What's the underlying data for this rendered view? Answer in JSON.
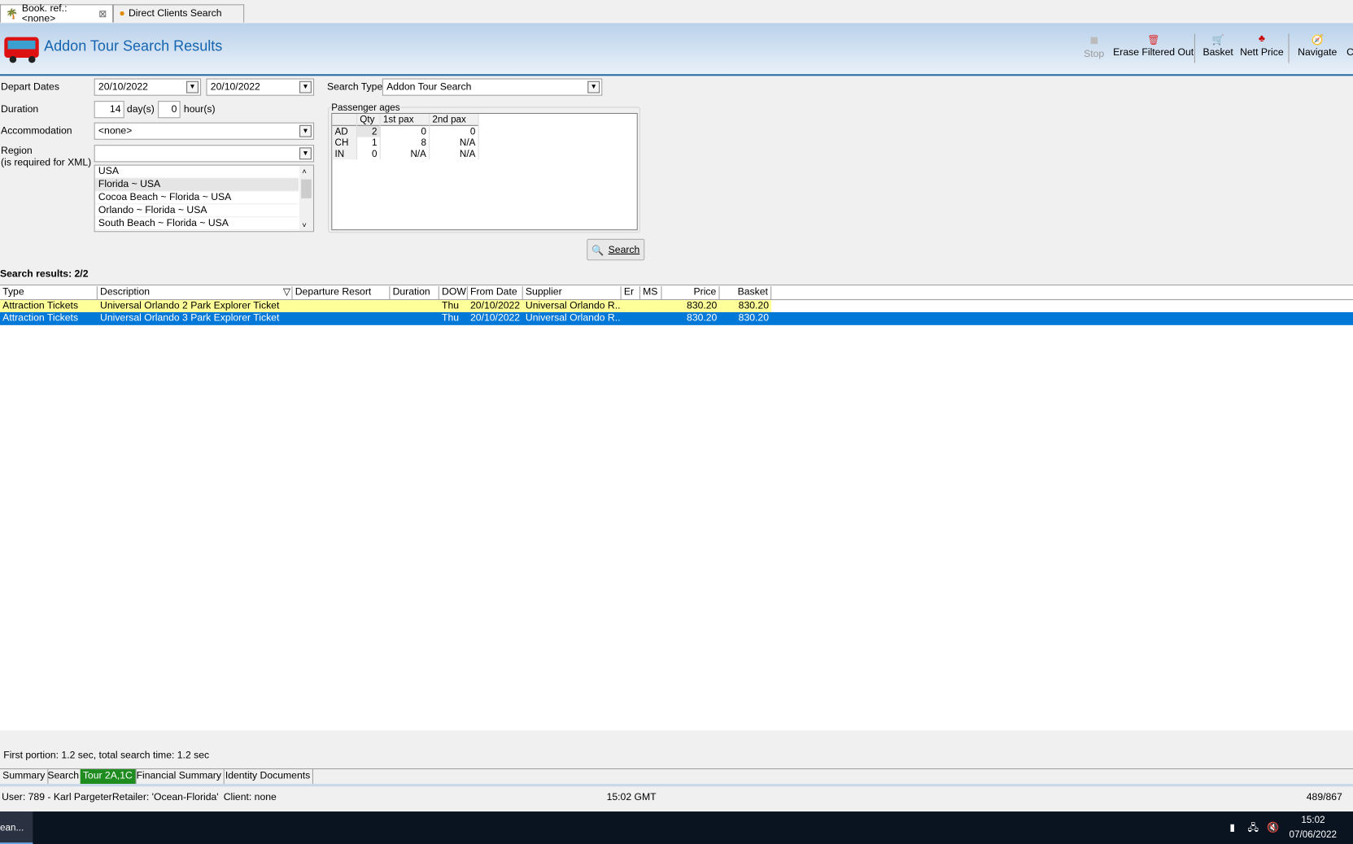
{
  "tabs": [
    {
      "label": "Book. ref.: <none>"
    },
    {
      "label": "Direct Clients Search"
    }
  ],
  "header": {
    "title": "Addon Tour Search Results"
  },
  "toolbar": {
    "stop": "Stop",
    "erase": "Erase Filtered Out",
    "basket": "Basket",
    "nett": "Nett Price",
    "navigate": "Navigate",
    "cl": "Cl"
  },
  "form": {
    "depart_label": "Depart Dates",
    "depart_from": "20/10/2022",
    "depart_to": "20/10/2022",
    "duration_label": "Duration",
    "days": "14",
    "days_unit": "day(s)",
    "hours": "0",
    "hours_unit": "hour(s)",
    "accommodation_label": "Accommodation",
    "accommodation": "<none>",
    "region_label": "Region",
    "region_note": "(is required for XML)",
    "region": "",
    "region_options": [
      "USA",
      "Florida ~ USA",
      "Cocoa Beach ~ Florida ~ USA",
      "Orlando ~ Florida ~ USA",
      "South Beach ~ Florida ~ USA"
    ],
    "search_type_label": "Search Type",
    "search_type": "Addon Tour Search",
    "pax_label": "Passenger ages",
    "pax_headers": [
      "",
      "Qty",
      "1st pax",
      "2nd pax"
    ],
    "pax_rows": [
      [
        "AD",
        "2",
        "0",
        "0"
      ],
      [
        "CH",
        "1",
        "8",
        "N/A"
      ],
      [
        "IN",
        "0",
        "N/A",
        "N/A"
      ]
    ],
    "search_button": "Search"
  },
  "results": {
    "summary": "Search results: 2/2",
    "columns": [
      "Type",
      "Description",
      "Departure Resort",
      "Duration",
      "DOW",
      "From Date",
      "Supplier",
      "Er",
      "MS",
      "Price",
      "Basket"
    ],
    "rows": [
      [
        "Attraction Tickets",
        "Universal Orlando 2 Park Explorer Ticket",
        "",
        "",
        "Thu",
        "20/10/2022",
        "Universal Orlando R...",
        "",
        "",
        "830.20",
        "830.20"
      ],
      [
        "Attraction Tickets",
        "Universal Orlando 3 Park Explorer Ticket",
        "",
        "",
        "Thu",
        "20/10/2022",
        "Universal Orlando R...",
        "",
        "",
        "830.20",
        "830.20"
      ]
    ]
  },
  "timing": "First portion: 1.2 sec, total search time: 1.2 sec",
  "bottom_tabs": [
    "Summary",
    "Search",
    "Tour 2A,1C",
    "Financial Summary",
    "Identity Documents"
  ],
  "status": {
    "user": "User: 789 - Karl Pargeter",
    "retailer": "Retailer: 'Ocean-Florida'",
    "client": "Client: none",
    "time": "15:02 GMT",
    "count": "489/867"
  },
  "taskbar": {
    "app": "ean...",
    "clock": "15:02",
    "date": "07/06/2022"
  },
  "colors": {
    "accent": "#0078d7",
    "highlight_row": "#ffff99",
    "active_tab": "#1e8c1e"
  }
}
